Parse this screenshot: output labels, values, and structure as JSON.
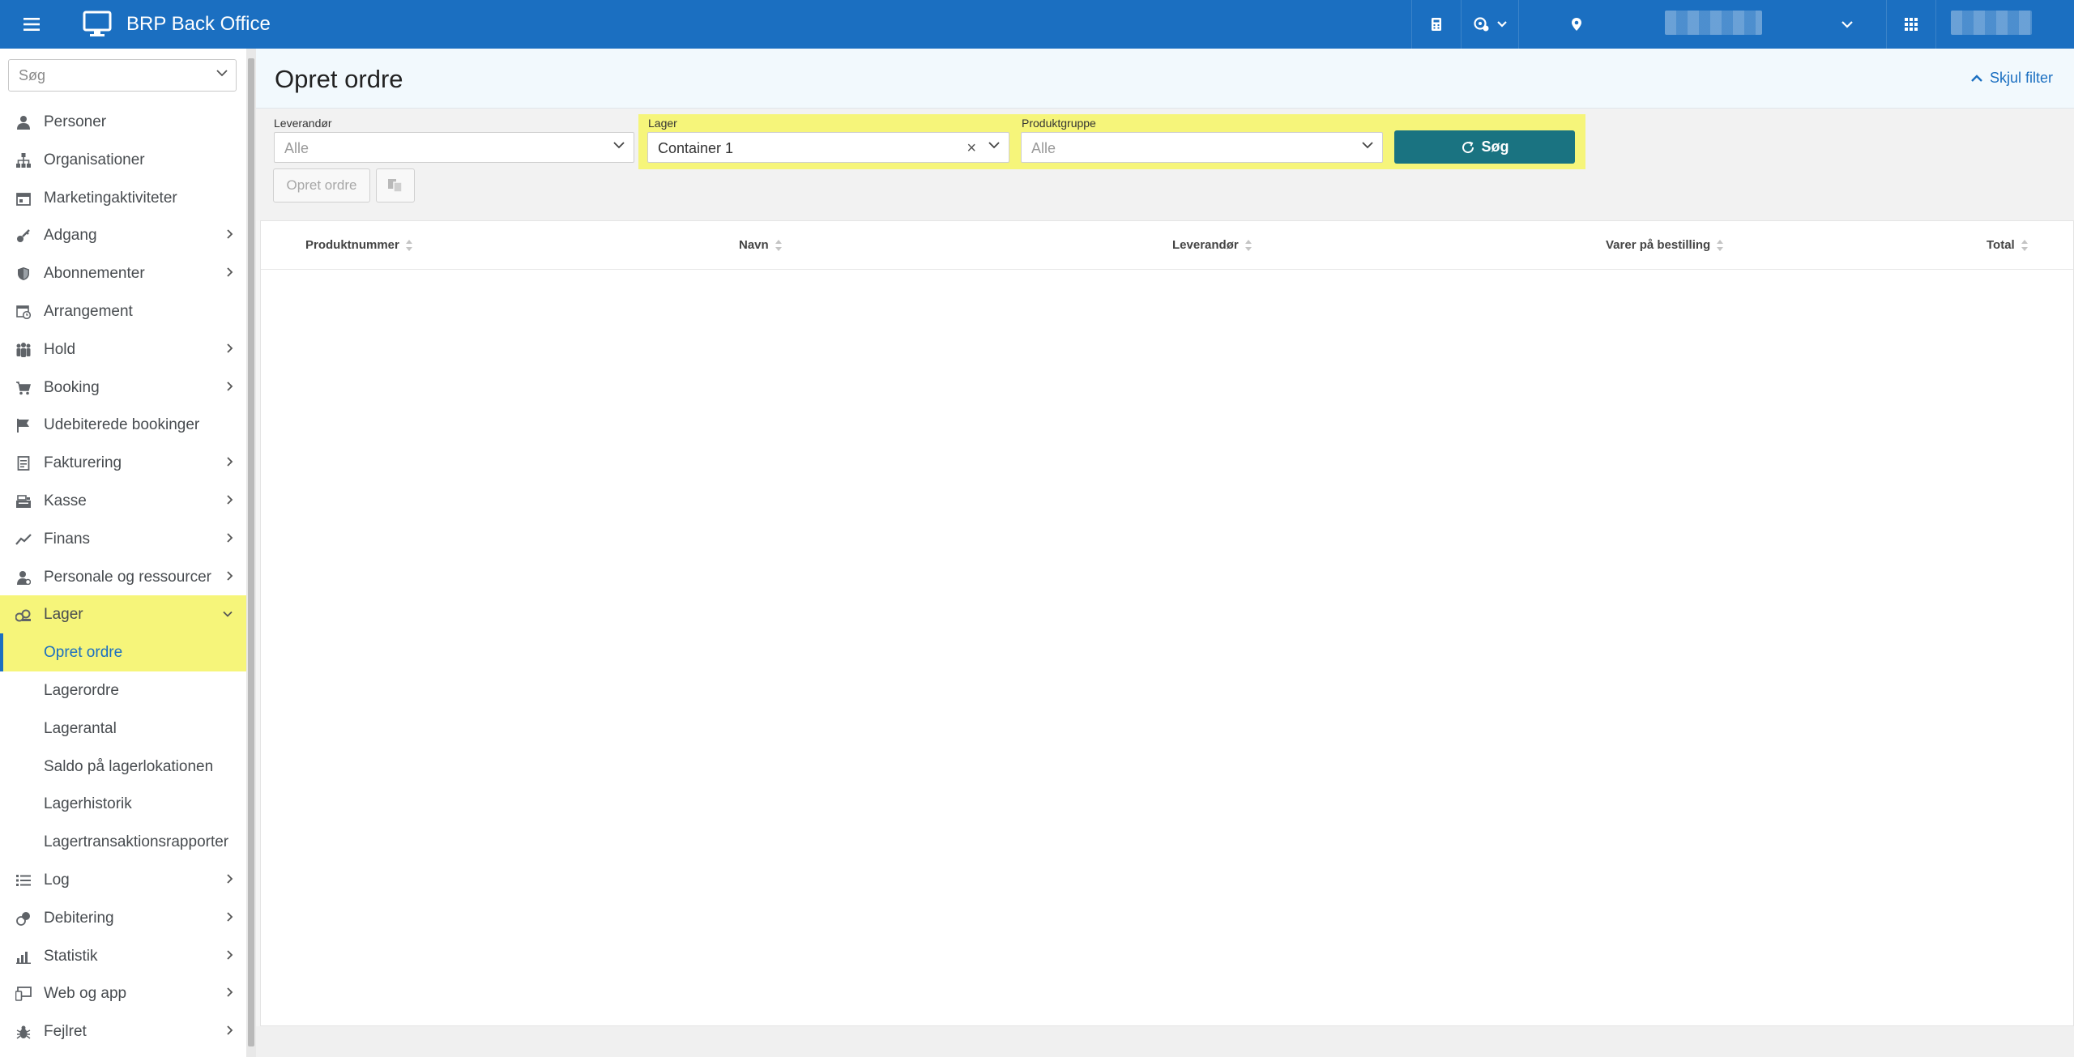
{
  "topbar": {
    "app_title": "BRP Back Office",
    "icons": [
      "menu-icon",
      "monitor-icon",
      "register-icon",
      "settings-network-icon",
      "location-icon",
      "apps-grid-icon"
    ]
  },
  "sidebar": {
    "search_placeholder": "Søg",
    "items": [
      {
        "label": "Personer",
        "icon": "person-icon"
      },
      {
        "label": "Organisationer",
        "icon": "org-tree-icon"
      },
      {
        "label": "Marketingaktiviteter",
        "icon": "calendar-icon"
      },
      {
        "label": "Adgang",
        "icon": "key-icon"
      },
      {
        "label": "Abonnementer",
        "icon": "shield-icon"
      },
      {
        "label": "Arrangement",
        "icon": "calendar-clock-icon"
      },
      {
        "label": "Hold",
        "icon": "group-icon"
      },
      {
        "label": "Booking",
        "icon": "cart-icon"
      },
      {
        "label": "Udebiterede bookinger",
        "icon": "flag-icon"
      },
      {
        "label": "Fakturering",
        "icon": "invoice-icon"
      },
      {
        "label": "Kasse",
        "icon": "cash-register-icon"
      },
      {
        "label": "Finans",
        "icon": "trend-icon"
      },
      {
        "label": "Personale og ressourcer",
        "icon": "staff-icon"
      },
      {
        "label": "Lager",
        "icon": "boxes-icon"
      },
      {
        "label": "Opret ordre"
      },
      {
        "label": "Lagerordre"
      },
      {
        "label": "Lagerantal"
      },
      {
        "label": "Saldo på lagerlokationen"
      },
      {
        "label": "Lagerhistorik"
      },
      {
        "label": "Lagertransaktionsrapporter"
      },
      {
        "label": "Log",
        "icon": "list-icon"
      },
      {
        "label": "Debitering",
        "icon": "coins-icon"
      },
      {
        "label": "Statistik",
        "icon": "bar-chart-icon"
      },
      {
        "label": "Web og app",
        "icon": "devices-icon"
      },
      {
        "label": "Fejlret",
        "icon": "bug-icon"
      }
    ]
  },
  "page": {
    "title": "Opret ordre",
    "hide_filter": "Skjul filter"
  },
  "filters": {
    "supplier": {
      "label": "Leverandør",
      "value": "Alle"
    },
    "warehouse": {
      "label": "Lager",
      "value": "Container 1"
    },
    "product_group": {
      "label": "Produktgruppe",
      "value": "Alle"
    },
    "search_button": "Søg"
  },
  "actions": {
    "create_order": "Opret ordre"
  },
  "table": {
    "columns": [
      "Produktnummer",
      "Navn",
      "Leverandør",
      "Varer på bestilling",
      "Total"
    ],
    "rows": []
  },
  "colors": {
    "topbar": "#1b6fc1",
    "highlight": "#f6f57a",
    "search_button": "#1a7381",
    "link": "#1b6fc1"
  }
}
